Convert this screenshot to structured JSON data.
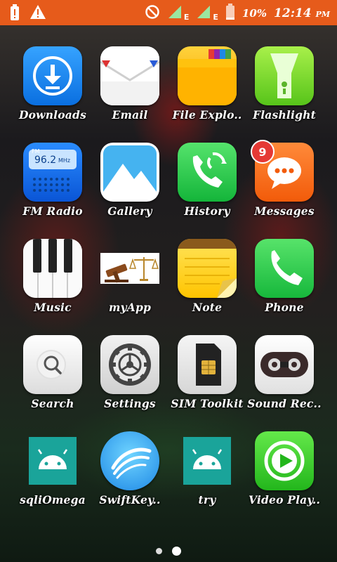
{
  "status_bar": {
    "time": "12:14",
    "ampm": "PM",
    "battery_percent": "10%",
    "network_type": "E"
  },
  "apps": [
    {
      "label": "Downloads",
      "icon": "download-icon"
    },
    {
      "label": "Email",
      "icon": "envelope-icon"
    },
    {
      "label": "File Explo..",
      "icon": "folder-icon"
    },
    {
      "label": "Flashlight",
      "icon": "flashlight-icon"
    },
    {
      "label": "FM Radio",
      "icon": "radio-icon",
      "freq": "96.2",
      "freq_unit": "MHz",
      "band": "FM"
    },
    {
      "label": "Gallery",
      "icon": "mountain-photo-icon"
    },
    {
      "label": "History",
      "icon": "phone-history-icon"
    },
    {
      "label": "Messages",
      "icon": "chat-bubble-icon",
      "badge": "9"
    },
    {
      "label": "Music",
      "icon": "piano-keys-icon"
    },
    {
      "label": "myApp",
      "icon": "gavel-scales-icon"
    },
    {
      "label": "Note",
      "icon": "notepad-icon"
    },
    {
      "label": "Phone",
      "icon": "phone-handset-icon"
    },
    {
      "label": "Search",
      "icon": "magnifier-icon"
    },
    {
      "label": "Settings",
      "icon": "gear-icon"
    },
    {
      "label": "SIM Toolkit",
      "icon": "sim-card-icon"
    },
    {
      "label": "Sound Rec..",
      "icon": "cassette-icon"
    },
    {
      "label": "sqliOmega",
      "icon": "android-icon"
    },
    {
      "label": "SwiftKey..",
      "icon": "swiftkey-icon"
    },
    {
      "label": "try",
      "icon": "android-icon"
    },
    {
      "label": "Video Play..",
      "icon": "play-icon"
    }
  ],
  "page_indicator": {
    "pages": 2,
    "current": 2
  }
}
